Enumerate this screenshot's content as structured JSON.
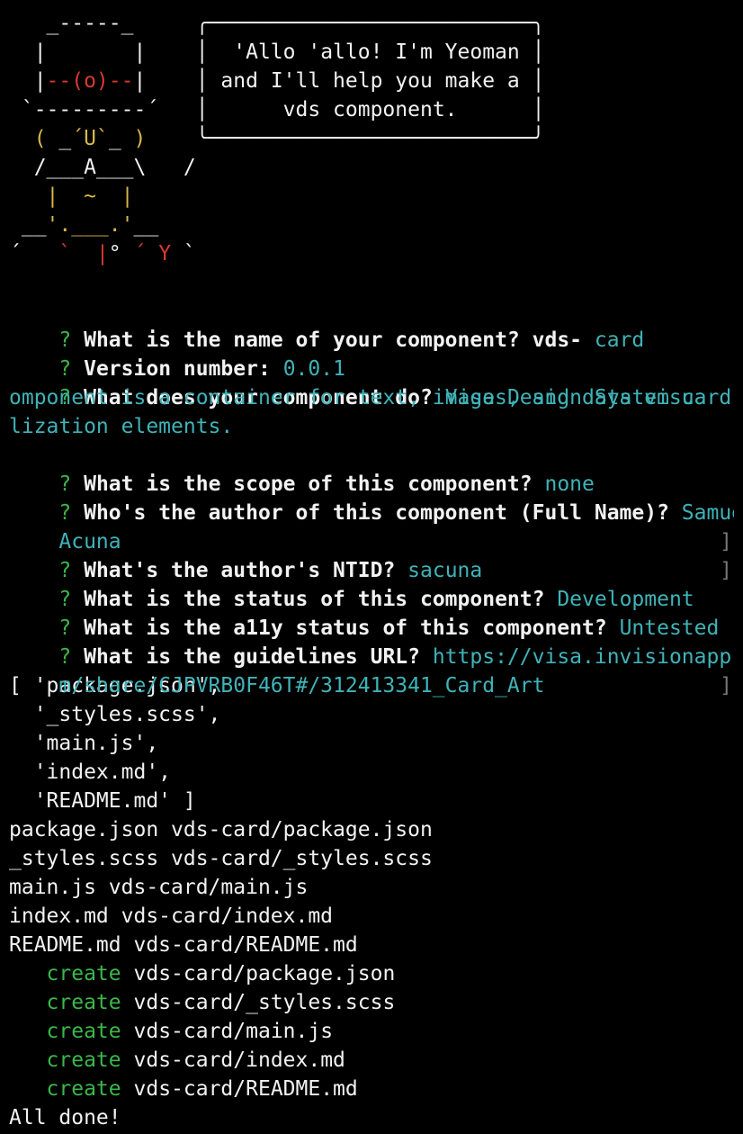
{
  "yeoman_art": [
    [
      {
        "t": "   _-----_     ",
        "c": "white"
      },
      {
        "t": "╭──────────────────────────╮",
        "c": "white"
      }
    ],
    [
      {
        "t": "  |       |    ",
        "c": "white"
      },
      {
        "t": "│  'Allo 'allo! I'm Yeoman │",
        "c": "white"
      }
    ],
    [
      {
        "t": "  |",
        "c": "white"
      },
      {
        "t": "--(o)--",
        "c": "red"
      },
      {
        "t": "|    ",
        "c": "white"
      },
      {
        "t": "│ and I'll help you make a │",
        "c": "white"
      }
    ],
    [
      {
        "t": " `---------´   ",
        "c": "white"
      },
      {
        "t": "│      vds component.      │",
        "c": "white"
      }
    ],
    [
      {
        "t": "  ",
        "c": "white"
      },
      {
        "t": "( ",
        "c": "yellow"
      },
      {
        "t": "_",
        "c": "white"
      },
      {
        "t": "´U`",
        "c": "yellow"
      },
      {
        "t": "_ ",
        "c": "white"
      },
      {
        "t": ")",
        "c": "yellow"
      },
      {
        "t": "    ",
        "c": "white"
      },
      {
        "t": "╰──────────────────────────╯",
        "c": "white"
      }
    ],
    [
      {
        "t": "  /___A___\\   /",
        "c": "white"
      }
    ],
    [
      {
        "t": "   ",
        "c": "white"
      },
      {
        "t": "|  ~  |",
        "c": "yellow"
      }
    ],
    [
      {
        "t": " __",
        "c": "white"
      },
      {
        "t": "'.___.'",
        "c": "yellow"
      },
      {
        "t": "__",
        "c": "white"
      }
    ],
    [
      {
        "t": "´   ",
        "c": "white"
      },
      {
        "t": "`  ",
        "c": "red"
      },
      {
        "t": "|",
        "c": "red"
      },
      {
        "t": "° ",
        "c": "white"
      },
      {
        "t": "´ Y",
        "c": "red"
      },
      {
        "t": " `",
        "c": "white"
      }
    ],
    [
      {
        "t": "",
        "c": "white"
      }
    ]
  ],
  "prompts": [
    {
      "q": "What is the name of your component?",
      "prefix": "vds-",
      "a": "card",
      "left_bracket": false,
      "right_bracket": false
    },
    {
      "q": "Version number:",
      "prefix": "",
      "a": "0.0.1",
      "left_bracket": false,
      "right_bracket": false
    },
    {
      "q": "What does your component do?",
      "prefix": "",
      "a": "Visa Design System card c",
      "left_bracket": false,
      "right_bracket": false
    }
  ],
  "wrapped_answer_lines": [
    "omponent is a container for text, images, and data visua",
    "lization elements."
  ],
  "prompts2": [
    {
      "q": "What is the scope of this component?",
      "a": "none"
    },
    {
      "q": "Who's the author of this component (Full Name)?",
      "a": "Samuel"
    }
  ],
  "author_wrap": "Acuna",
  "ntid_prompt": {
    "q": "What's the author's NTID?",
    "a": "sacuna"
  },
  "prompts3": [
    {
      "q": "What is the status of this component?",
      "a": "Development"
    },
    {
      "q": "What is the a11y status of this component?",
      "a": "Untested"
    },
    {
      "q": "What is the guidelines URL?",
      "a": "https://visa.invisionapp.co"
    }
  ],
  "url_wrap": "m/share/CJPVRB0F46T#/312413341_Card_Art",
  "file_array": [
    "[ 'package.json',",
    "  '_styles.scss',",
    "  'main.js',",
    "  'index.md',",
    "  'README.md' ]"
  ],
  "copy_lines": [
    "package.json vds-card/package.json",
    "_styles.scss vds-card/_styles.scss",
    "main.js vds-card/main.js",
    "index.md vds-card/index.md",
    "README.md vds-card/README.md"
  ],
  "create_label": "create",
  "created_files": [
    "vds-card/package.json",
    "vds-card/_styles.scss",
    "vds-card/main.js",
    "vds-card/index.md",
    "vds-card/README.md"
  ],
  "done_text": "All done!",
  "question_mark": "?"
}
